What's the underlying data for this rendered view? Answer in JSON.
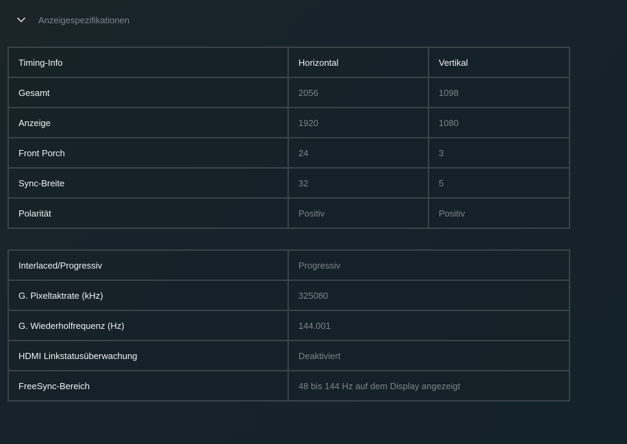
{
  "section": {
    "title": "Anzeigespezifikationen",
    "icon": "chevron-down-icon"
  },
  "timing": {
    "headers": [
      "Timing-Info",
      "Horizontal",
      "Vertikal"
    ],
    "rows": [
      {
        "label": "Gesamt",
        "horizontal": "2056",
        "vertical": "1098"
      },
      {
        "label": "Anzeige",
        "horizontal": "1920",
        "vertical": "1080"
      },
      {
        "label": "Front Porch",
        "horizontal": "24",
        "vertical": "3"
      },
      {
        "label": "Sync-Breite",
        "horizontal": "32",
        "vertical": "5"
      },
      {
        "label": "Polarität",
        "horizontal": "Positiv",
        "vertical": "Positiv"
      }
    ]
  },
  "details": {
    "rows": [
      {
        "label": "Interlaced/Progressiv",
        "value": "Progressiv"
      },
      {
        "label": "G. Pixeltaktrate (kHz)",
        "value": "325080"
      },
      {
        "label": "G. Wiederholfrequenz (Hz)",
        "value": "144.001"
      },
      {
        "label": "HDMI Linkstatusüberwachung",
        "value": "Deaktiviert"
      },
      {
        "label": "FreeSync-Bereich",
        "value": "48 bis 144 Hz auf dem Display angezeigt"
      }
    ]
  },
  "colors": {
    "background": "#16232a",
    "border": "#3a4348",
    "label_text": "#f0f2f3",
    "value_text": "#7c8489"
  }
}
